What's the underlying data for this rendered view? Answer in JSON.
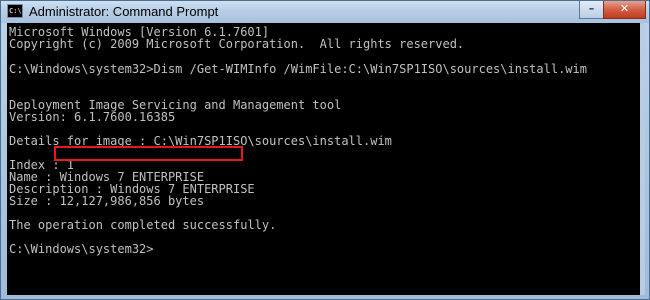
{
  "window": {
    "title": "Administrator: Command Prompt",
    "icon_name": "cmd-icon",
    "minimize_glyph": "–",
    "close_glyph": "✕"
  },
  "console": {
    "lines": [
      "Microsoft Windows [Version 6.1.7601]",
      "Copyright (c) 2009 Microsoft Corporation.  All rights reserved.",
      "",
      "C:\\Windows\\system32>Dism /Get-WIMInfo /WimFile:C:\\Win7SP1ISO\\sources\\install.wim",
      "",
      "Deployment Image Servicing and Management tool",
      "Version: 6.1.7600.16385",
      "",
      "Details for image : C:\\Win7SP1ISO\\sources\\install.wim",
      "",
      "Index : 1",
      "Name : Windows 7 ENTERPRISE",
      "Description : Windows 7 ENTERPRISE",
      "Size : 12,127,986,856 bytes",
      "",
      "The operation completed successfully.",
      "",
      "C:\\Windows\\system32>"
    ]
  },
  "colors": {
    "console_background": "#000000",
    "console_text": "#c0c0c0",
    "highlight_box": "#e8161d"
  }
}
